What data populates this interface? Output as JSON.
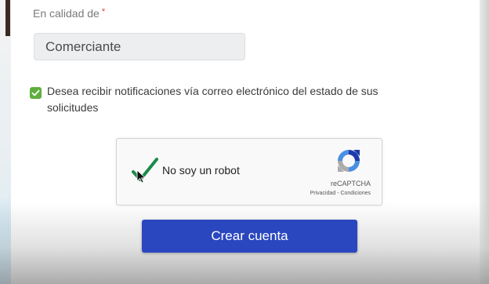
{
  "form": {
    "role_label": "En calidad de",
    "required_mark": "*",
    "role_value": "Comerciante",
    "notification_checkbox_checked": true,
    "notification_text": "Desea recibir notificaciones vía correo electrónico del estado de sus solicitudes",
    "submit_label": "Crear cuenta"
  },
  "recaptcha": {
    "label": "No soy un robot",
    "brand": "reCAPTCHA",
    "links": "Privacidad - Condiciones",
    "checked": true
  },
  "colors": {
    "checkbox": "#5fae3d",
    "button": "#2a47bf",
    "required": "#e53935"
  }
}
